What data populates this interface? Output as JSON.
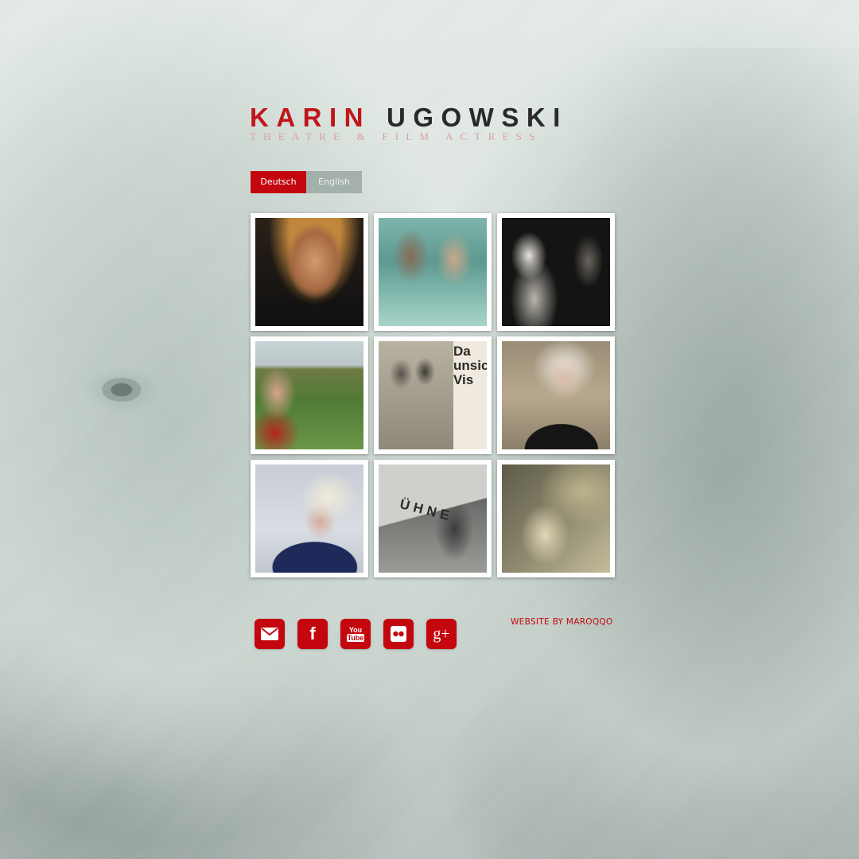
{
  "header": {
    "first_name": "KARIN",
    "last_name": "UGOWSKI",
    "subtitle": "THEATRE & FILM ACTRESS"
  },
  "language": {
    "de_label": "Deutsch",
    "en_label": "English"
  },
  "gallery": {
    "p5_text": "Da\nunsic\nVis",
    "p8_text": "ÜHNE"
  },
  "social": {
    "icons": [
      "email-icon",
      "facebook-icon",
      "youtube-icon",
      "flickr-icon",
      "google-plus-icon"
    ],
    "youtube_text_1": "You",
    "youtube_text_2": "Tube",
    "google_text": "g+",
    "facebook_text": "f"
  },
  "footer": {
    "credit": "WEBSITE BY MAROQQO"
  },
  "colors": {
    "accent": "#c4070f",
    "language_inactive": "#a4b0aa"
  }
}
